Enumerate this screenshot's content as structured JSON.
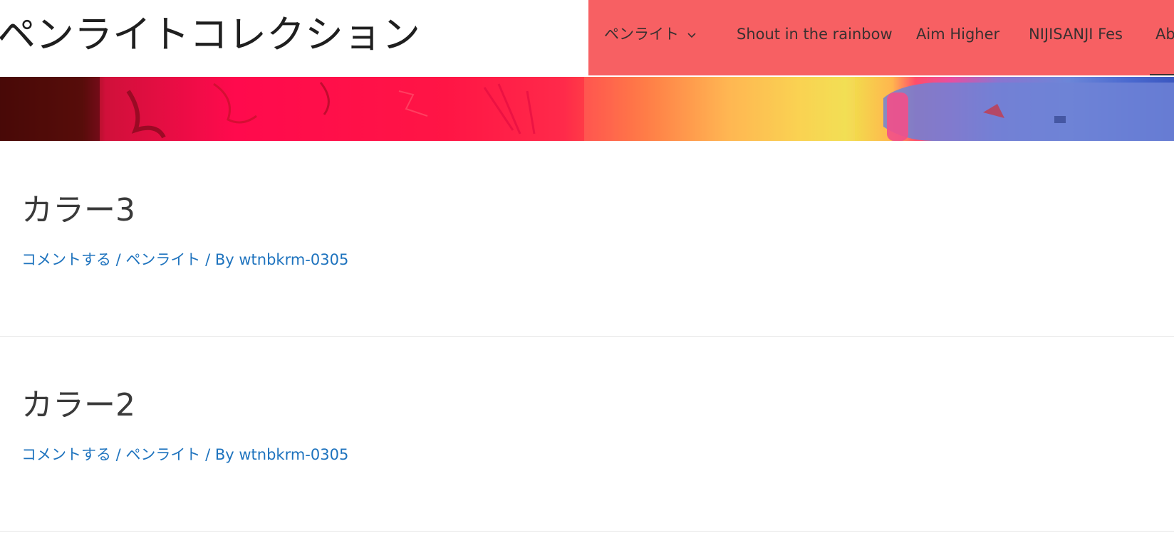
{
  "site": {
    "title": "ペンライトコレクション"
  },
  "nav": {
    "items": [
      {
        "label": "ペンライト",
        "has_submenu": true
      },
      {
        "label": "Shout in the rainbow"
      },
      {
        "label": "Aim Higher"
      },
      {
        "label": "NIJISANJI Fes"
      },
      {
        "label": "Ab"
      }
    ],
    "background_color": "#f76063",
    "text_color": "#3a3030"
  },
  "hero": {
    "description_colors": [
      "#ff0a4d",
      "#f0e24c",
      "#6c86d8"
    ]
  },
  "posts": [
    {
      "title": "カラー3",
      "comment_link": "コメントする",
      "sep1": " / ",
      "category": "ペンライト",
      "sep2": " / By ",
      "author": "wtnbkrm-0305"
    },
    {
      "title": "カラー2",
      "comment_link": "コメントする",
      "sep1": " / ",
      "category": "ペンライト",
      "sep2": " / By ",
      "author": "wtnbkrm-0305"
    }
  ],
  "colors": {
    "link": "#1e73be",
    "title": "#3a3a3a"
  }
}
